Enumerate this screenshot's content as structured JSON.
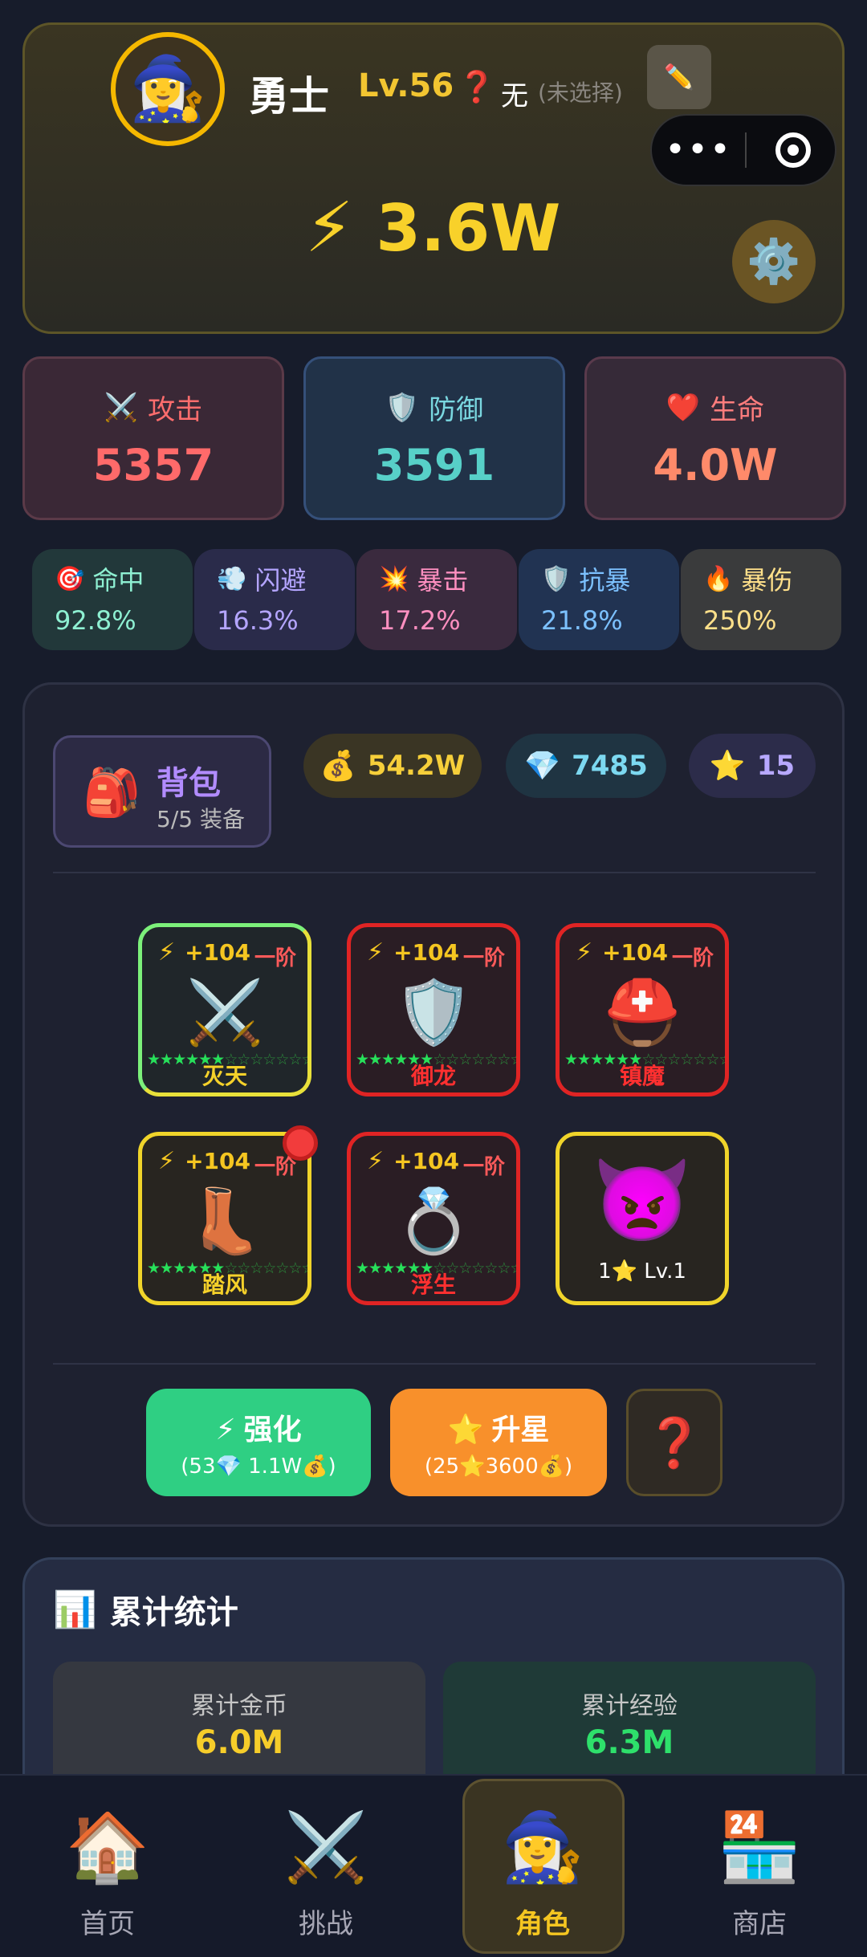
{
  "player": {
    "avatar_icon": "🧙‍♀️",
    "name": "勇士",
    "level": "Lv.56",
    "title_icon": "❓",
    "title_value": "无",
    "title_hint": "(未选择)",
    "edit_icon": "✏️",
    "power_icon": "⚡",
    "power": "3.6W",
    "settings_icon": "⚙️"
  },
  "main_stats": [
    {
      "icon": "⚔️",
      "label": "攻击",
      "value": "5357"
    },
    {
      "icon": "🛡️",
      "label": "防御",
      "value": "3591"
    },
    {
      "icon": "❤️",
      "label": "生命",
      "value": "4.0W"
    }
  ],
  "sub_stats": [
    {
      "icon": "🎯",
      "label": "命中",
      "value": "92.8%"
    },
    {
      "icon": "💨",
      "label": "闪避",
      "value": "16.3%"
    },
    {
      "icon": "💥",
      "label": "暴击",
      "value": "17.2%"
    },
    {
      "icon": "🛡️",
      "label": "抗暴",
      "value": "21.8%"
    },
    {
      "icon": "🔥",
      "label": "暴伤",
      "value": "250%"
    }
  ],
  "bag": {
    "icon": "🎒",
    "title": "背包",
    "subtitle": "5/5 装备"
  },
  "resources": [
    {
      "icon": "💰",
      "value": "54.2W"
    },
    {
      "icon": "💎",
      "value": "7485"
    },
    {
      "icon": "⭐",
      "value": "15"
    }
  ],
  "equipment": [
    {
      "bolt": "⚡",
      "power": "+104",
      "tier": "一阶",
      "icon": "⚔️",
      "stars": "★★★★★★",
      "stars_empty": "☆☆☆☆☆☆☆☆☆☆",
      "name": "灭天"
    },
    {
      "bolt": "⚡",
      "power": "+104",
      "tier": "一阶",
      "icon": "🛡️",
      "stars": "★★★★★★",
      "stars_empty": "☆☆☆☆☆☆☆☆☆☆",
      "name": "御龙"
    },
    {
      "bolt": "⚡",
      "power": "+104",
      "tier": "一阶",
      "icon": "⛑️",
      "stars": "★★★★★★",
      "stars_empty": "☆☆☆☆☆☆☆☆☆☆",
      "name": "镇魔"
    },
    {
      "bolt": "⚡",
      "power": "+104",
      "tier": "一阶",
      "icon": "👢",
      "stars": "★★★★★★",
      "stars_empty": "☆☆☆☆☆☆☆☆☆☆",
      "name": "踏风"
    },
    {
      "bolt": "⚡",
      "power": "+104",
      "tier": "一阶",
      "icon": "💍",
      "stars": "★★★★★★",
      "stars_empty": "☆☆☆☆☆☆☆☆☆☆",
      "name": "浮生"
    }
  ],
  "pet": {
    "icon": "👿",
    "label": "1⭐ Lv.1"
  },
  "actions": {
    "enhance": {
      "icon": "⚡",
      "label": "强化",
      "cost": "(53💎 1.1W💰)"
    },
    "star_up": {
      "icon": "⭐",
      "label": "升星",
      "cost": "(25⭐3600💰)"
    },
    "help_icon": "❓"
  },
  "statistics": {
    "icon": "📊",
    "title": "累计统计",
    "gold_label": "累计金币",
    "gold_value": "6.0M",
    "exp_label": "累计经验",
    "exp_value": "6.3M"
  },
  "nav": [
    {
      "icon": "🏠",
      "label": "首页"
    },
    {
      "icon": "⚔️",
      "label": "挑战"
    },
    {
      "icon": "🧙‍♀️",
      "label": "角色"
    },
    {
      "icon": "🏪",
      "label": "商店"
    }
  ],
  "capsule": {
    "more": "•••"
  }
}
